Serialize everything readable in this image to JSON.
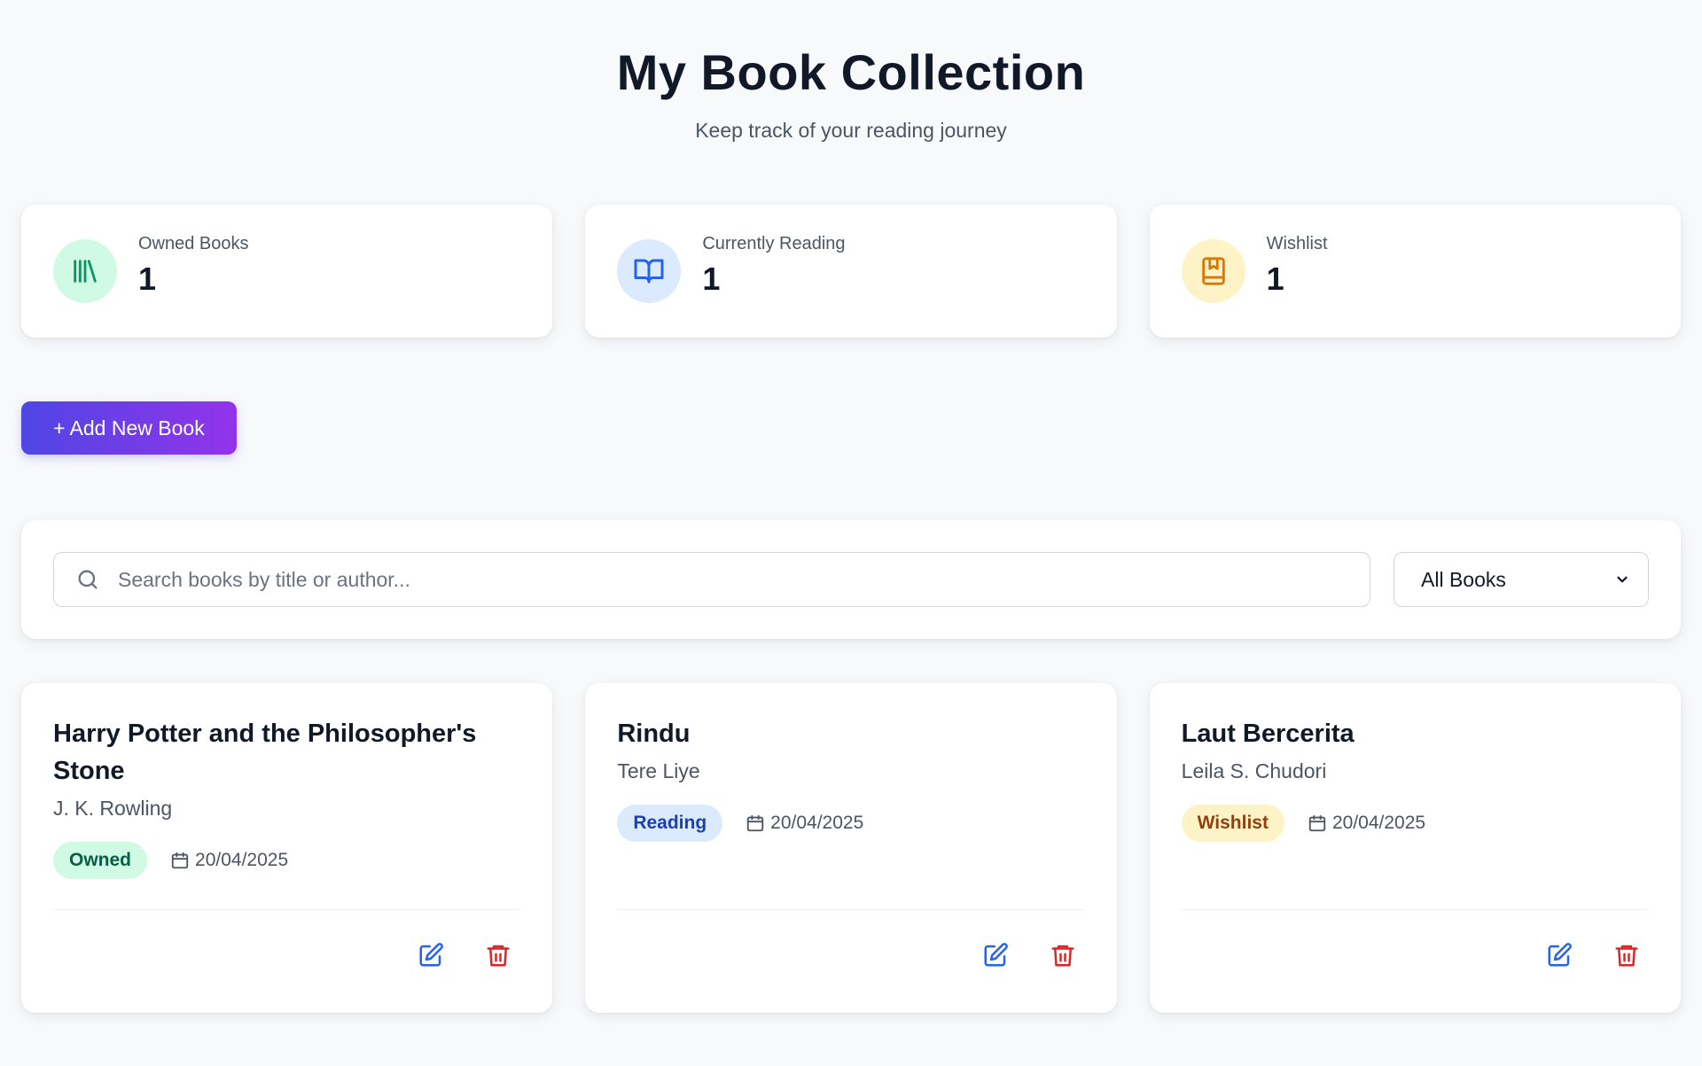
{
  "header": {
    "title": "My Book Collection",
    "subtitle": "Keep track of your reading journey"
  },
  "stats": [
    {
      "label": "Owned Books",
      "value": "1",
      "icon": "library-icon",
      "color": "#059669"
    },
    {
      "label": "Currently Reading",
      "value": "1",
      "icon": "open-book-icon",
      "color": "#2563eb"
    },
    {
      "label": "Wishlist",
      "value": "1",
      "icon": "bookmark-book-icon",
      "color": "#d97706"
    }
  ],
  "toolbar": {
    "add_label": "+ Add New Book"
  },
  "search": {
    "placeholder": "Search books by title or author...",
    "value": "",
    "filter_selected": "All Books"
  },
  "books": [
    {
      "title": "Harry Potter and the Philosopher's Stone",
      "author": "J. K. Rowling",
      "status": "Owned",
      "date": "20/04/2025"
    },
    {
      "title": "Rindu",
      "author": "Tere Liye",
      "status": "Reading",
      "date": "20/04/2025"
    },
    {
      "title": "Laut Bercerita",
      "author": "Leila S. Chudori",
      "status": "Wishlist",
      "date": "20/04/2025"
    }
  ],
  "colors": {
    "accent_start": "#4f46e5",
    "accent_end": "#9333ea",
    "edit": "#2563eb",
    "delete": "#dc2626"
  }
}
